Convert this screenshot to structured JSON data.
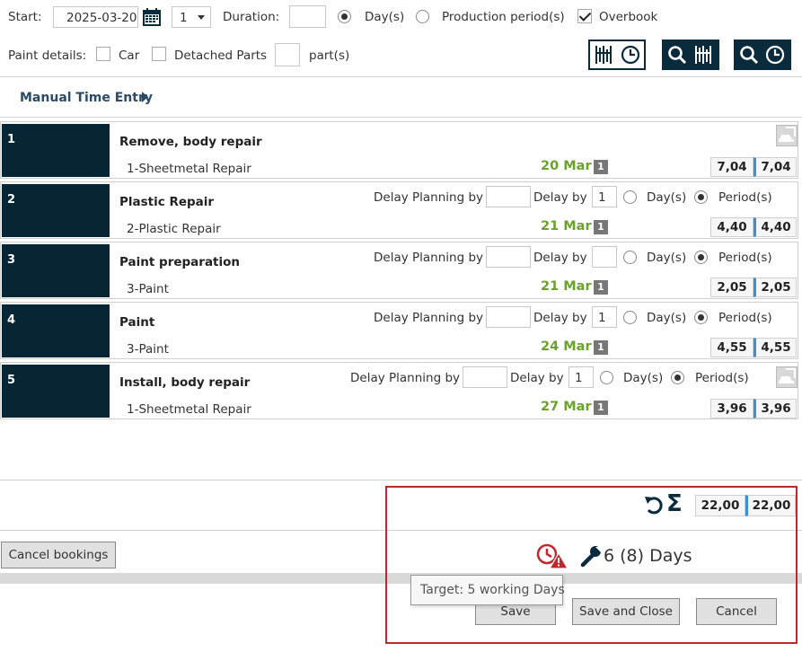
{
  "toolbar": {
    "start_label": "Start:",
    "start_value": "2025-03-20",
    "count_value": "1",
    "duration_label": "Duration:",
    "duration_value": "",
    "days_label": "Day(s)",
    "production_period_label": "Production period(s)",
    "overbook_label": "Overbook",
    "paint_details_label": "Paint details:",
    "car_label": "Car",
    "detached_parts_label": "Detached Parts",
    "parts_value": "",
    "parts_label": "part(s)"
  },
  "manual_time_entry_label": "Manual Time Entry",
  "delay_labels": {
    "planning": "Delay Planning by",
    "delay": "Delay by",
    "days": "Day(s)",
    "periods": "Period(s)"
  },
  "rows": [
    {
      "num": "1",
      "title": "Remove, body repair",
      "sub": "1-Sheetmetal Repair",
      "date": "20 Mar",
      "period": "1",
      "v1": "7,04",
      "v2": "7,04",
      "delay_by": ""
    },
    {
      "num": "2",
      "title": "Plastic Repair",
      "sub": "2-Plastic Repair",
      "date": "21 Mar",
      "period": "1",
      "v1": "4,40",
      "v2": "4,40",
      "delay_by": "1"
    },
    {
      "num": "3",
      "title": "Paint preparation",
      "sub": "3-Paint",
      "date": "21 Mar",
      "period": "1",
      "v1": "2,05",
      "v2": "2,05",
      "delay_by": ""
    },
    {
      "num": "4",
      "title": "Paint",
      "sub": "3-Paint",
      "date": "24 Mar",
      "period": "1",
      "v1": "4,55",
      "v2": "4,55",
      "delay_by": "1"
    },
    {
      "num": "5",
      "title": "Install, body repair",
      "sub": "1-Sheetmetal Repair",
      "date": "27 Mar",
      "period": "1",
      "v1": "3,96",
      "v2": "3,96",
      "delay_by": "1"
    }
  ],
  "totals": {
    "v1": "22,00",
    "v2": "22,00"
  },
  "days_summary": "6 (8) Days",
  "tooltip": "Target: 5 working Days",
  "buttons": {
    "cancel_bookings": "Cancel bookings",
    "save": "Save",
    "save_and_close": "Save and Close",
    "cancel": "Cancel"
  },
  "colors": {
    "dark_navy": "#0a2b3c",
    "date_green": "#6aa22c",
    "highlight_red": "#c0282d",
    "value_blue": "#3a8fd6"
  }
}
